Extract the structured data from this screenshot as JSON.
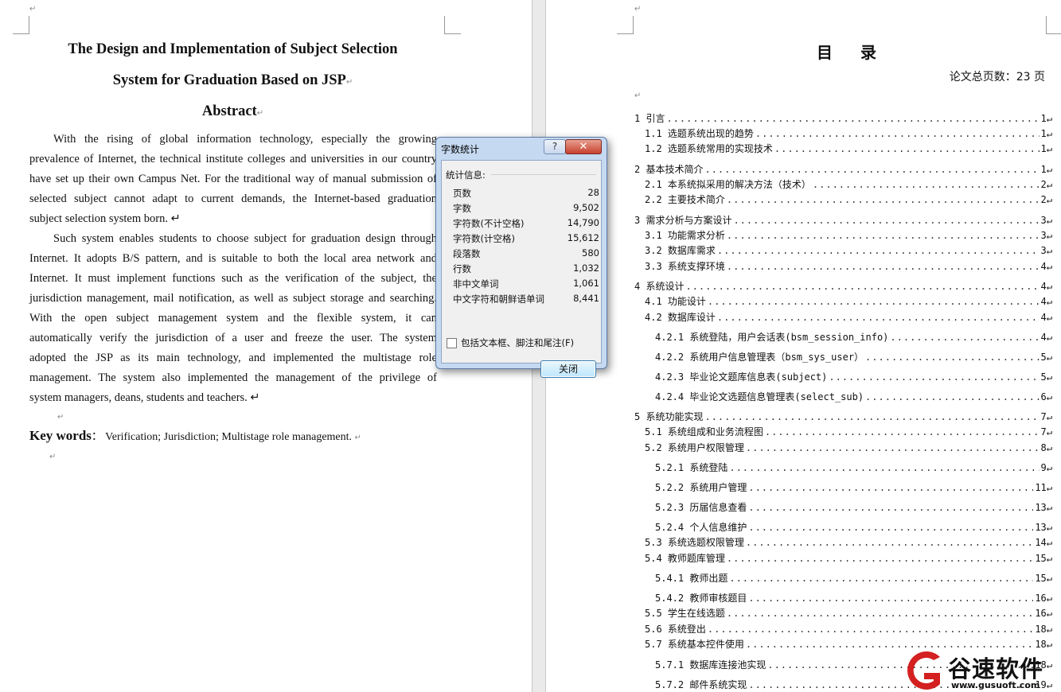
{
  "left_page": {
    "title_line1": "The Design and Implementation of Subject Selection",
    "title_line2": "System for Graduation Based on JSP",
    "abstract_heading": "Abstract",
    "para_mark": "↵",
    "para1_lines": [
      "With the rising of global information technology, especially the growing",
      "prevalence of Internet, the technical institute colleges and universities in our country",
      "have set up their own Campus Net. For the traditional way of manual submission of",
      "selected subject cannot adapt to current demands, the Internet-based graduation",
      "subject selection system born."
    ],
    "para2_lines": [
      "Such system enables students to choose subject for graduation design through",
      "Internet. It adopts B/S pattern, and is suitable to both the local area network and",
      "Internet. It must implement functions such as the verification of the subject, the",
      "jurisdiction management, mail notification, as well as subject storage and searching.",
      "With the open subject management system and the flexible system, it can",
      "automatically verify the jurisdiction of a user and freeze the user. The system",
      "adopted the JSP as its main technology, and implemented the multistage role",
      "management. The system also implemented the management of the privilege of",
      "system managers, deans, students and teachers."
    ],
    "keywords_label": "Key words",
    "keywords_sep": "：",
    "keywords_text": "Verification; Jurisdiction; Multistage role management."
  },
  "right_page": {
    "toc_title": "目 录",
    "total_pages": "论文总页数：23 页",
    "toc": [
      {
        "label": "1 引言",
        "page": "1"
      },
      {
        "label": "1.1 选题系统出现的趋势",
        "page": "1"
      },
      {
        "label": "1.2 选题系统常用的实现技术",
        "page": "1"
      },
      {
        "label": "2 基本技术简介",
        "page": "1"
      },
      {
        "label": "2.1 本系统拟采用的解决方法（技术）",
        "page": "2"
      },
      {
        "label": "2.2 主要技术简介",
        "page": "2"
      },
      {
        "label": "3 需求分析与方案设计 ",
        "page": "3"
      },
      {
        "label": "3.1 功能需求分析",
        "page": "3"
      },
      {
        "label": "3.2 数据库需求",
        "page": "3"
      },
      {
        "label": "3.3 系统支撑环境",
        "page": "4"
      },
      {
        "label": "4 系统设计",
        "page": "4"
      },
      {
        "label": "4.1 功能设计 ",
        "page": "4"
      },
      {
        "label": "4.2 数据库设计 ",
        "page": "4"
      },
      {
        "label": "4.2.1 系统登陆，用户会话表(bsm_session_info)",
        "page": "4"
      },
      {
        "label": "4.2.2 系统用户信息管理表（bsm_sys_user）",
        "page": "5"
      },
      {
        "label": "4.2.3 毕业论文题库信息表(subject)",
        "page": "5"
      },
      {
        "label": "4.2.4 毕业论文选题信息管理表(select_sub)",
        "page": "6"
      },
      {
        "label": "5 系统功能实现 ",
        "page": "7"
      },
      {
        "label": "5.1 系统组成和业务流程图",
        "page": "7"
      },
      {
        "label": "5.2 系统用户权限管理",
        "page": "8"
      },
      {
        "label": "5.2.1 系统登陆 ",
        "page": "9"
      },
      {
        "label": "5.2.2 系统用户管理",
        "page": "11"
      },
      {
        "label": "5.2.3 历届信息查看 ",
        "page": "13"
      },
      {
        "label": "5.2.4 个人信息维护 ",
        "page": "13"
      },
      {
        "label": "5.3 系统选题权限管理",
        "page": "14"
      },
      {
        "label": "5.4 教师题库管理",
        "page": "15"
      },
      {
        "label": "5.4.1 教师出题",
        "page": "15"
      },
      {
        "label": "5.4.2 教师审核题目",
        "page": "16"
      },
      {
        "label": "5.5 学生在线选题",
        "page": "16"
      },
      {
        "label": "5.6 系统登出",
        "page": "18"
      },
      {
        "label": "5.7 系统基本控件使用",
        "page": "18"
      },
      {
        "label": "5.7.1 数据库连接池实现",
        "page": "18"
      },
      {
        "label": "5.7.2 邮件系统实现",
        "page": "19"
      }
    ]
  },
  "dialog": {
    "title": "字数统计",
    "help_label": "?",
    "close_x_label": "✕",
    "section_label": "统计信息:",
    "stats": [
      {
        "label": "页数",
        "value": "28"
      },
      {
        "label": "字数",
        "value": "9,502"
      },
      {
        "label": "字符数(不计空格)",
        "value": "14,790"
      },
      {
        "label": "字符数(计空格)",
        "value": "15,612"
      },
      {
        "label": "段落数",
        "value": "580"
      },
      {
        "label": "行数",
        "value": "1,032"
      },
      {
        "label": "非中文单词",
        "value": "1,061"
      },
      {
        "label": "中文字符和朝鲜语单词",
        "value": "8,441"
      }
    ],
    "checkbox_label": "包括文本框、脚注和尾注(F)",
    "checkbox_checked": false,
    "close_button": "关闭"
  },
  "watermark": {
    "name": "谷速软件",
    "url": "www.gusuoft.com",
    "color": "#d42020"
  }
}
